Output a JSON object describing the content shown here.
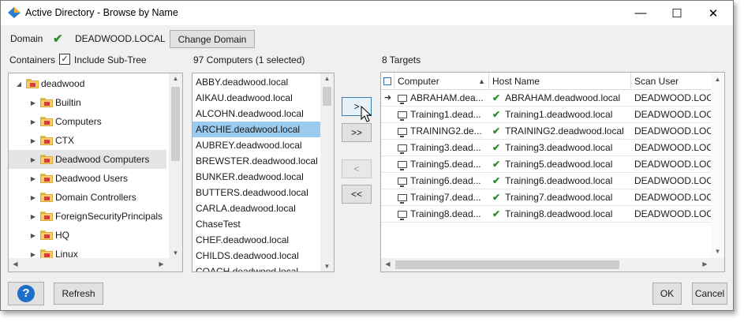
{
  "window": {
    "title": "Active Directory - Browse by Name"
  },
  "controls": {
    "minimize": "—",
    "maximize": "☐",
    "close": "✕"
  },
  "domain": {
    "label": "Domain",
    "value": "DEADWOOD.LOCAL",
    "change_button": "Change Domain"
  },
  "containers": {
    "label": "Containers",
    "include_subtree": "Include Sub-Tree",
    "tree": [
      {
        "label": "deadwood",
        "level": 0,
        "expanded": true
      },
      {
        "label": "Builtin",
        "level": 1
      },
      {
        "label": "Computers",
        "level": 1
      },
      {
        "label": "CTX",
        "level": 1
      },
      {
        "label": "Deadwood Computers",
        "level": 1,
        "selected": true
      },
      {
        "label": "Deadwood Users",
        "level": 1
      },
      {
        "label": "Domain Controllers",
        "level": 1
      },
      {
        "label": "ForeignSecurityPrincipals",
        "level": 1
      },
      {
        "label": "HQ",
        "level": 1
      },
      {
        "label": "Linux",
        "level": 1
      }
    ]
  },
  "computers": {
    "header": "97 Computers (1 selected)",
    "items": [
      "ABBY.deadwood.local",
      "AIKAU.deadwood.local",
      "ALCOHN.deadwood.local",
      "ARCHIE.deadwood.local",
      "AUBREY.deadwood.local",
      "BREWSTER.deadwood.local",
      "BUNKER.deadwood.local",
      "BUTTERS.deadwood.local",
      "CARLA.deadwood.local",
      "ChaseTest",
      "CHEF.deadwood.local",
      "CHILDS.deadwood.local",
      "COACH.deadwood.local"
    ],
    "selected_index": 3
  },
  "transfer": {
    "add": ">",
    "add_all": ">>",
    "remove": "<",
    "remove_all": "<<"
  },
  "targets": {
    "header": "8 Targets",
    "columns": [
      "Computer",
      "Host Name",
      "Scan User"
    ],
    "rows": [
      {
        "computer": "ABRAHAM.dea...",
        "host": "ABRAHAM.deadwood.local",
        "user": "DEADWOOD.LOCA"
      },
      {
        "computer": "Training1.dead...",
        "host": "Training1.deadwood.local",
        "user": "DEADWOOD.LOCA"
      },
      {
        "computer": "TRAINING2.de...",
        "host": "TRAINING2.deadwood.local",
        "user": "DEADWOOD.LOCA"
      },
      {
        "computer": "Training3.dead...",
        "host": "Training3.deadwood.local",
        "user": "DEADWOOD.LOCA"
      },
      {
        "computer": "Training5.dead...",
        "host": "Training5.deadwood.local",
        "user": "DEADWOOD.LOCA"
      },
      {
        "computer": "Training6.dead...",
        "host": "Training6.deadwood.local",
        "user": "DEADWOOD.LOCA"
      },
      {
        "computer": "Training7.dead...",
        "host": "Training7.deadwood.local",
        "user": "DEADWOOD.LOCA"
      },
      {
        "computer": "Training8.dead...",
        "host": "Training8.deadwood.local",
        "user": "DEADWOOD.LOCA"
      }
    ]
  },
  "footer": {
    "help": "?",
    "refresh": "Refresh",
    "ok": "OK",
    "cancel": "Cancel"
  },
  "colors": {
    "accent": "#1e6fc8",
    "selection": "#9ccbf0",
    "check": "#2e8b2e"
  }
}
